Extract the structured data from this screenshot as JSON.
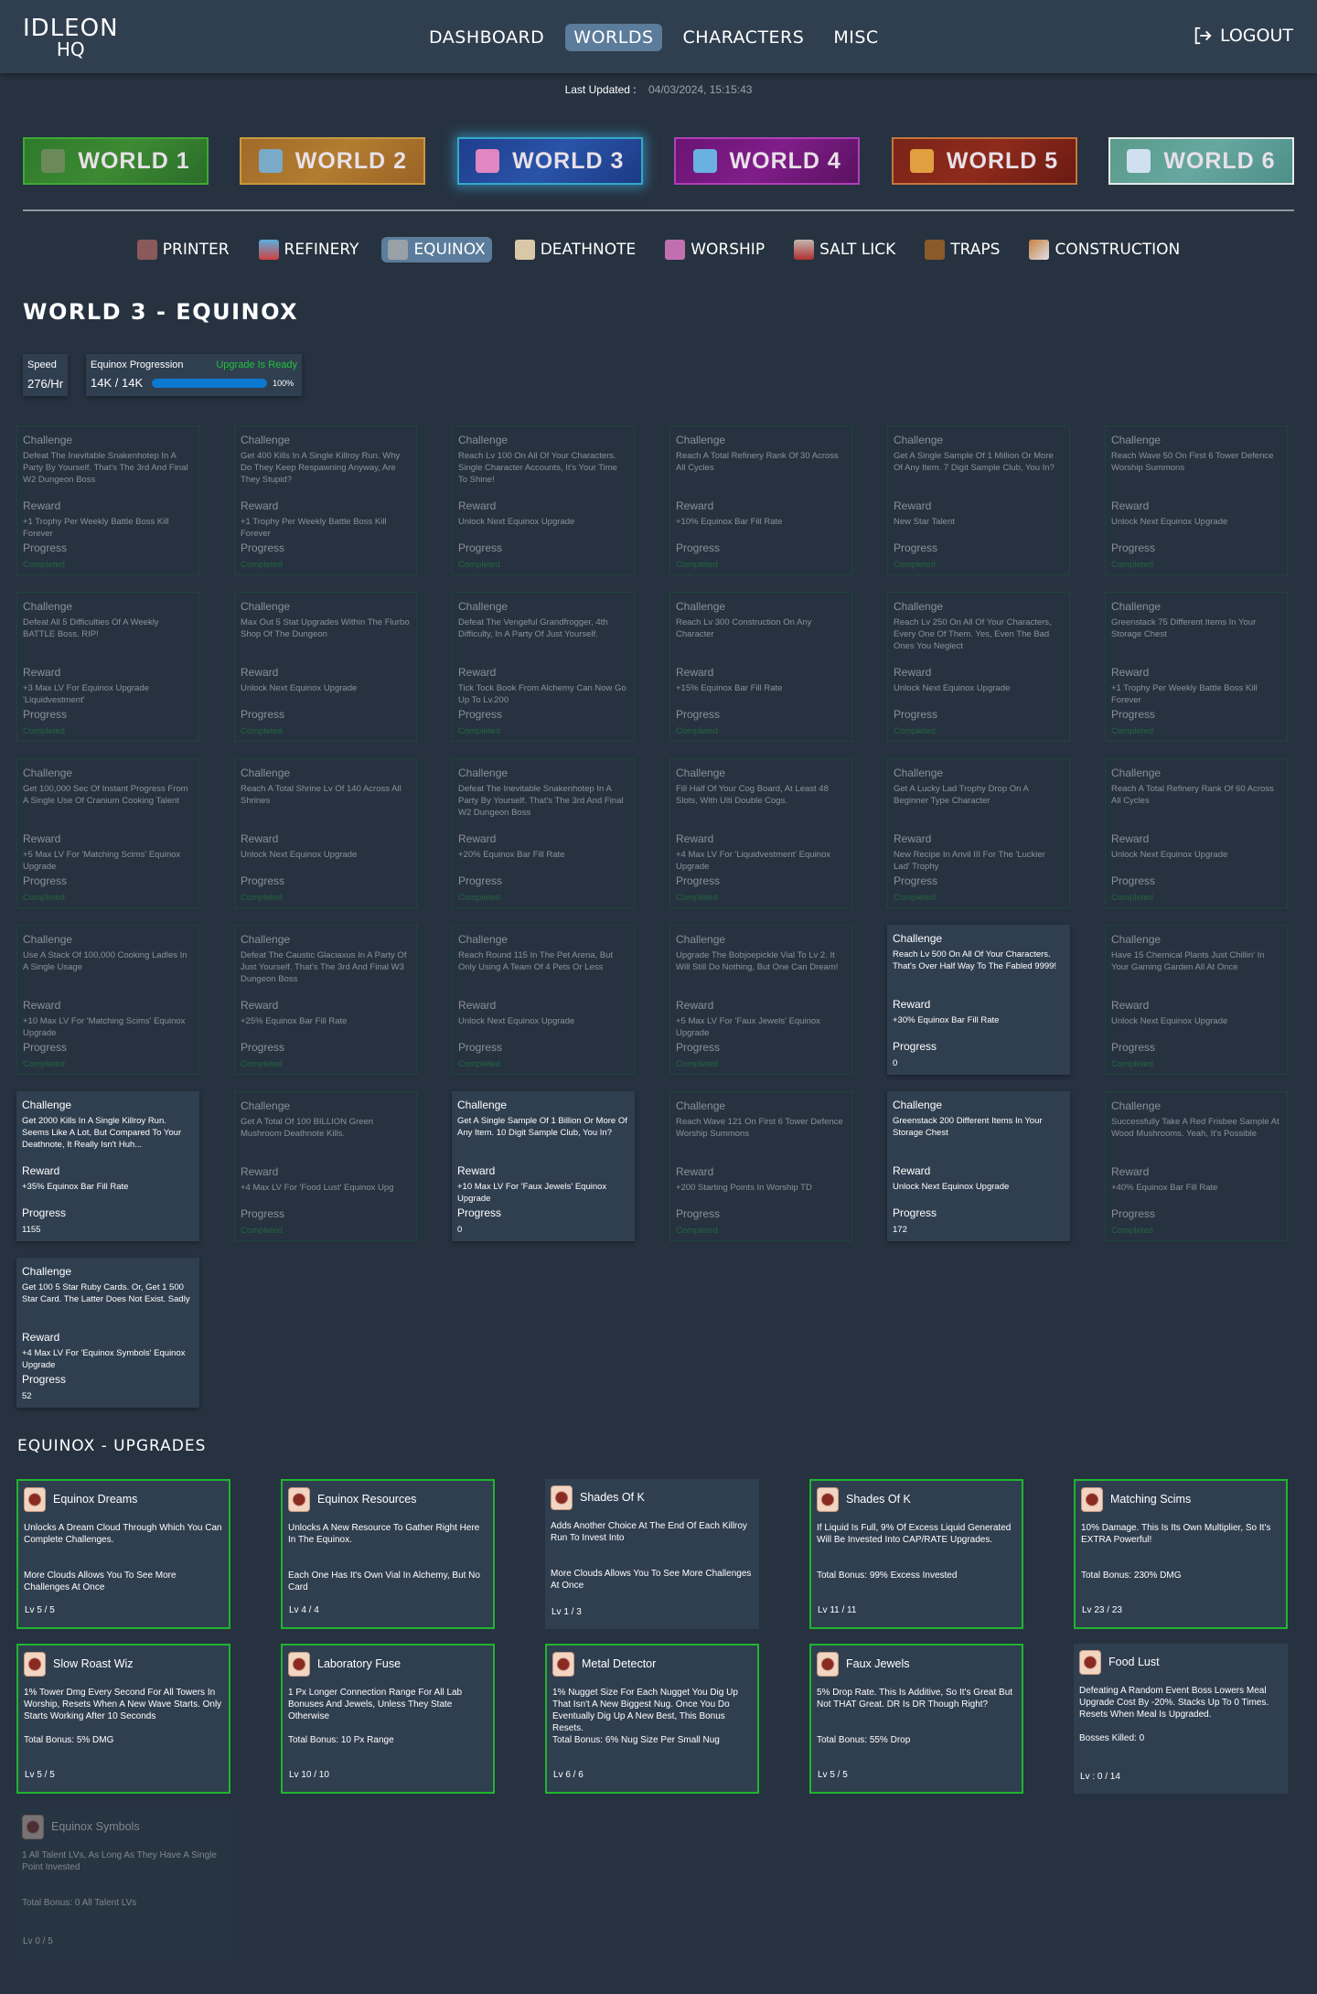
{
  "header": {
    "logo_line1": "IDLEON",
    "logo_line2": "HQ",
    "nav": [
      {
        "label": "DASHBOARD",
        "active": false
      },
      {
        "label": "WORLDS",
        "active": true
      },
      {
        "label": "CHARACTERS",
        "active": false
      },
      {
        "label": "MISC",
        "active": false
      }
    ],
    "logout_label": "LOGOUT"
  },
  "last_updated": {
    "label": "Last Updated :",
    "value": "04/03/2024, 15:15:43"
  },
  "worlds": [
    {
      "label": "WORLD 1",
      "active": false
    },
    {
      "label": "WORLD 2",
      "active": false
    },
    {
      "label": "WORLD 3",
      "active": true
    },
    {
      "label": "WORLD 4",
      "active": false
    },
    {
      "label": "WORLD 5",
      "active": false
    },
    {
      "label": "WORLD 6",
      "active": false
    }
  ],
  "subnav": [
    {
      "label": "PRINTER",
      "icon": "printer-icon",
      "active": false
    },
    {
      "label": "REFINERY",
      "icon": "refinery-icon",
      "active": false
    },
    {
      "label": "EQUINOX",
      "icon": "equinox-icon",
      "active": true
    },
    {
      "label": "DEATHNOTE",
      "icon": "deathnote-icon",
      "active": false
    },
    {
      "label": "WORSHIP",
      "icon": "worship-icon",
      "active": false
    },
    {
      "label": "SALT LICK",
      "icon": "salt-lick-icon",
      "active": false
    },
    {
      "label": "TRAPS",
      "icon": "traps-icon",
      "active": false
    },
    {
      "label": "CONSTRUCTION",
      "icon": "construction-icon",
      "active": false
    }
  ],
  "page_title": "WORLD 3 - EQUINOX",
  "speed": {
    "label": "Speed",
    "value": "276/Hr"
  },
  "progression": {
    "label": "Equinox Progression",
    "status": "Upgrade Is Ready",
    "value": "14K / 14K",
    "percent_label": "100%",
    "percent": 100
  },
  "challenge_labels": {
    "challenge": "Challenge",
    "reward": "Reward",
    "progress": "Progress"
  },
  "challenges": [
    {
      "desc": "Defeat The Inevitable Snakenhotep In A Party By Yourself. That's The 3rd And Final W2 Dungeon Boss",
      "reward": "+1 Trophy Per Weekly Battle Boss Kill Forever",
      "progress": "Completed",
      "done": true
    },
    {
      "desc": "Get 400 Kills In A Single Killroy Run. Why Do They Keep Respawning Anyway, Are They Stupid?",
      "reward": "+1 Trophy Per Weekly Battle Boss Kill Forever",
      "progress": "Completed",
      "done": true
    },
    {
      "desc": "Reach Lv 100 On All Of Your Characters. Single Character Accounts, It's Your Time To Shine!",
      "reward": "Unlock Next Equinox Upgrade",
      "progress": "Completed",
      "done": true
    },
    {
      "desc": "Reach A Total Refinery Rank Of 30 Across All Cycles",
      "reward": "+10% Equinox Bar Fill Rate",
      "progress": "Completed",
      "done": true
    },
    {
      "desc": "Get A Single Sample Of 1 Million Or More Of Any Item. 7 Digit Sample Club, You In?",
      "reward": "New Star Talent",
      "progress": "Completed",
      "done": true
    },
    {
      "desc": "Reach Wave 50 On First 6 Tower Defence Worship Summons",
      "reward": "Unlock Next Equinox Upgrade",
      "progress": "Completed",
      "done": true
    },
    {
      "desc": "Defeat All 5 Difficulties Of A Weekly BATTLE Boss. RIP!",
      "reward": "+3 Max LV For Equinox Upgrade 'Liquidvestment'",
      "progress": "Completed",
      "done": true
    },
    {
      "desc": "Max Out 5 Stat Upgrades Within The Flurbo Shop Of The Dungeon",
      "reward": "Unlock Next Equinox Upgrade",
      "progress": "Completed",
      "done": true
    },
    {
      "desc": "Defeat The Vengeful Grandfrogger, 4th Difficulty, In A Party Of Just Yourself.",
      "reward": "Tick Tock Book From Alchemy Can Now Go Up To Lv.200",
      "progress": "Completed",
      "done": true
    },
    {
      "desc": "Reach Lv 300 Construction On Any Character",
      "reward": "+15% Equinox Bar Fill Rate",
      "progress": "Completed",
      "done": true
    },
    {
      "desc": "Reach Lv 250 On All Of Your Characters, Every One Of Them. Yes, Even The Bad Ones You Neglect",
      "reward": "Unlock Next Equinox Upgrade",
      "progress": "Completed",
      "done": true
    },
    {
      "desc": "Greenstack 75 Different Items In Your Storage Chest",
      "reward": "+1 Trophy Per Weekly Battle Boss Kill Forever",
      "progress": "Completed",
      "done": true
    },
    {
      "desc": "Get 100,000 Sec Of Instant Progress From A Single Use Of Cranium Cooking Talent",
      "reward": "+5 Max LV For 'Matching Scims' Equinox Upgrade",
      "progress": "Completed",
      "done": true
    },
    {
      "desc": "Reach A Total Shrine Lv Of 140 Across All Shrines",
      "reward": "Unlock Next Equinox Upgrade",
      "progress": "Completed",
      "done": true
    },
    {
      "desc": "Defeat The Inevitable Snakenhotep In A Party By Yourself. That's The 3rd And Final W2 Dungeon Boss",
      "reward": "+20% Equinox Bar Fill Rate",
      "progress": "Completed",
      "done": true
    },
    {
      "desc": "Fill Half Of Your Cog Board, At Least 48 Slots, With Ulti Double Cogs.",
      "reward": "+4 Max LV For 'Liquidvestment' Equinox Upgrade",
      "progress": "Completed",
      "done": true
    },
    {
      "desc": "Get A Lucky Lad Trophy Drop On A Beginner Type Character",
      "reward": "New Recipe In Anvil III For The 'Luckier Lad' Trophy",
      "progress": "Completed",
      "done": true
    },
    {
      "desc": "Reach A Total Refinery Rank Of 60 Across All Cycles",
      "reward": "Unlock Next Equinox Upgrade",
      "progress": "Completed",
      "done": true
    },
    {
      "desc": "Use A Stack Of 100,000 Cooking Ladles In A Single Usage",
      "reward": "+10 Max LV For 'Matching Scims' Equinox Upgrade",
      "progress": "Completed",
      "done": true
    },
    {
      "desc": "Defeat The Caustic Glaciaxus In A Party Of Just Yourself. That's The 3rd And Final W3 Dungeon Boss",
      "reward": "+25% Equinox Bar Fill Rate",
      "progress": "Completed",
      "done": true
    },
    {
      "desc": "Reach Round 115 In The Pet Arena, But Only Using A Team Of 4 Pets Or Less",
      "reward": "Unlock Next Equinox Upgrade",
      "progress": "Completed",
      "done": true
    },
    {
      "desc": "Upgrade The Bobjoepickle Vial To Lv 2. It Will Still Do Nothing, But One Can Dream!",
      "reward": "+5 Max LV For 'Faux Jewels' Equinox Upgrade",
      "progress": "Completed",
      "done": true
    },
    {
      "desc": "Reach Lv 500 On All Of Your Characters. That's Over Half Way To The Fabled 9999!",
      "reward": "+30% Equinox Bar Fill Rate",
      "progress": "0",
      "done": false
    },
    {
      "desc": "Have 15 Chemical Plants Just Chillin' In Your Gaming Garden All At Once",
      "reward": "Unlock Next Equinox Upgrade",
      "progress": "Completed",
      "done": true
    },
    {
      "desc": "Get 2000 Kills In A Single Killroy Run. Seems Like A Lot, But Compared To Your Deathnote, It Really Isn't Huh...",
      "reward": "+35% Equinox Bar Fill Rate",
      "progress": "1155",
      "done": false
    },
    {
      "desc": "Get A Total Of 100 BILLION Green Mushroom Deathnote Kills.",
      "reward": "+4 Max LV For 'Food Lust' Equinox Upg",
      "progress": "Completed",
      "done": true
    },
    {
      "desc": "Get A Single Sample Of 1 Billion Or More Of Any Item. 10 Digit Sample Club, You In?",
      "reward": "+10 Max LV For 'Faux Jewels' Equinox Upgrade",
      "progress": "0",
      "done": false
    },
    {
      "desc": "Reach Wave 121 On First 6 Tower Defence Worship Summons",
      "reward": "+200 Starting Points In Worship TD",
      "progress": "Completed",
      "done": true
    },
    {
      "desc": "Greenstack 200 Different Items In Your Storage Chest",
      "reward": "Unlock Next Equinox Upgrade",
      "progress": "172",
      "done": false
    },
    {
      "desc": "Successfully Take A Red Frisbee Sample At Wood Mushrooms. Yeah, It's Possible",
      "reward": "+40% Equinox Bar Fill Rate",
      "progress": "Completed",
      "done": true
    },
    {
      "desc": "Get 100 5 Star Ruby Cards. Or, Get 1 500 Star Card. The Latter Does Not Exist. Sadly",
      "reward": "+4 Max LV For 'Equinox Symbols' Equinox Upgrade",
      "progress": "52",
      "done": false
    }
  ],
  "upgrades_title": "EQUINOX - UPGRADES",
  "upgrades": [
    {
      "name": "Equinox Dreams",
      "icon": "equinox-dreams-icon",
      "desc": "Unlocks A Dream Cloud Through Which You Can Complete Challenges.",
      "bonus": "More Clouds Allows You To See More Challenges At Once",
      "level": "Lv 5 / 5",
      "state": "maxed"
    },
    {
      "name": "Equinox Resources",
      "icon": "equinox-resources-icon",
      "desc": "Unlocks A New Resource To Gather Right Here In The Equinox.",
      "bonus": "Each One Has It's Own Vial In Alchemy, But No Card",
      "level": "Lv 4 / 4",
      "state": "maxed"
    },
    {
      "name": "Shades Of K",
      "icon": "shades-of-k-icon",
      "desc": "Adds Another Choice At The End Of Each Killroy Run To Invest Into",
      "bonus": "More Clouds Allows You To See More Challenges At Once",
      "level": "Lv 1 / 3",
      "state": "normal"
    },
    {
      "name": "Shades Of K",
      "icon": "liquidvestment-icon",
      "desc": "If Liquid Is Full, 9% Of Excess Liquid Generated Will Be Invested Into CAP/RATE Upgrades.",
      "bonus": "Total Bonus: 99% Excess Invested",
      "level": "Lv 11 / 11",
      "state": "maxed"
    },
    {
      "name": "Matching Scims",
      "icon": "matching-scims-icon",
      "desc": "10% Damage. This Is Its Own Multiplier, So It's EXTRA Powerful!",
      "bonus": "Total Bonus: 230% DMG",
      "level": "Lv 23 / 23",
      "state": "maxed"
    },
    {
      "name": "Slow Roast Wiz",
      "icon": "slow-roast-wiz-icon",
      "desc": "1% Tower Dmg Every Second For All Towers In Worship, Resets When A New Wave Starts. Only Starts Working After 10 Seconds",
      "bonus": "Total Bonus: 5% DMG",
      "level": "Lv 5 / 5",
      "state": "maxed"
    },
    {
      "name": "Laboratory Fuse",
      "icon": "laboratory-fuse-icon",
      "desc": "1 Px Longer Connection Range For All Lab Bonuses And Jewels, Unless They State Otherwise",
      "bonus": "Total Bonus: 10 Px Range",
      "level": "Lv 10 / 10",
      "state": "maxed"
    },
    {
      "name": "Metal Detector",
      "icon": "metal-detector-icon",
      "desc": "1% Nugget Size For Each Nugget You Dig Up That Isn't A New Biggest Nug. Once You Do Eventually Dig Up A New Best, This Bonus Resets.",
      "bonus": "Total Bonus: 6% Nug Size Per Small Nug",
      "level": "Lv 6 / 6",
      "state": "maxed"
    },
    {
      "name": "Faux Jewels",
      "icon": "faux-jewels-icon",
      "desc": "5% Drop Rate. This Is Additive, So It's Great But Not THAT Great. DR Is DR Though Right?",
      "bonus": "Total Bonus: 55% Drop",
      "level": "Lv 5 / 5",
      "state": "maxed"
    },
    {
      "name": "Food Lust",
      "icon": "food-lust-icon",
      "desc": "Defeating A Random Event Boss Lowers Meal Upgrade Cost By -20%. Stacks Up To 0 Times. Resets When Meal Is Upgraded.",
      "bonus": "Bosses Killed: 0",
      "level": "Lv : 0 / 14",
      "state": "normal"
    },
    {
      "name": "Equinox Symbols",
      "icon": "equinox-symbols-icon",
      "desc": "1 All Talent LVs, As Long As They Have A Single Point Invested",
      "bonus": "Total Bonus: 0 All Talent LVs",
      "level": "Lv 0 / 5",
      "state": "locked"
    }
  ],
  "colors": {
    "accent": "#5b7c9b",
    "ready": "#1fc23a",
    "progress_bar": "#0d78d0",
    "maxed_border": "#1fb52f"
  }
}
